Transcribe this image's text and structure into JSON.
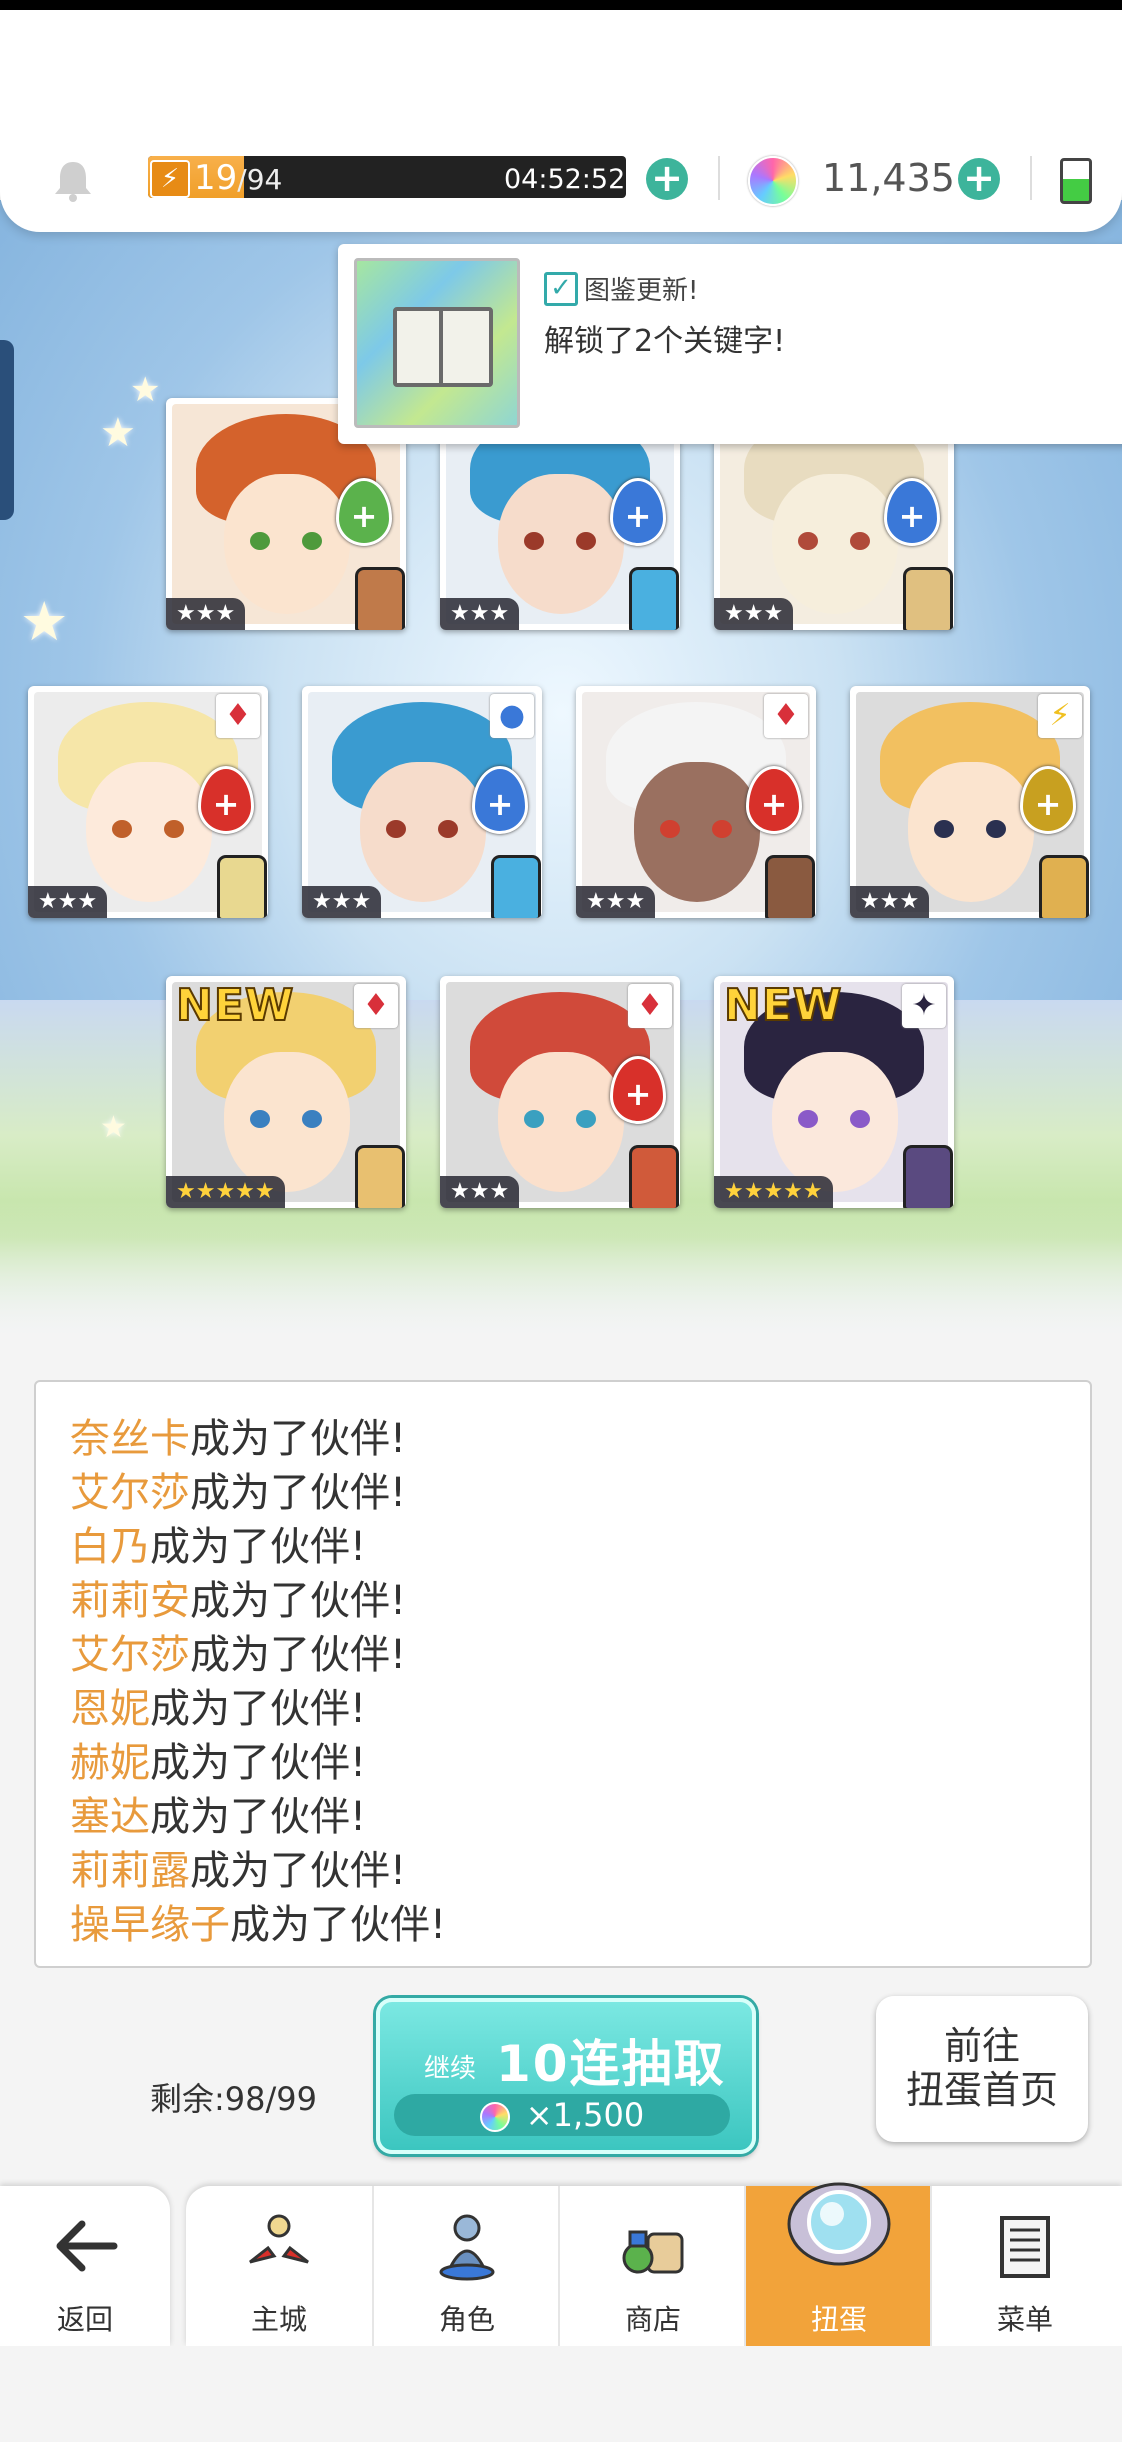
{
  "status": {
    "stamina_current": "19",
    "stamina_max": "/94",
    "stamina_fraction": 0.2,
    "timer": "04:52:52",
    "gems": "11,435"
  },
  "toast": {
    "title": "图鉴更新!",
    "body": "解锁了2个关键字!"
  },
  "cards": [
    {
      "stars": "★★★"
    },
    {
      "stars": "★★★"
    },
    {
      "stars": "★★★"
    },
    {
      "stars": "★★★"
    },
    {
      "stars": "★★★"
    },
    {
      "stars": "★★★"
    },
    {
      "stars": "★★★"
    },
    {
      "stars": "★★★★★",
      "new": "NEW"
    },
    {
      "stars": "★★★"
    },
    {
      "stars": "★★★★★",
      "new": "NEW"
    }
  ],
  "log": {
    "suffix": "成为了伙伴!",
    "names": [
      "奈丝卡",
      "艾尔莎",
      "白乃",
      "莉莉安",
      "艾尔莎",
      "恩妮",
      "赫妮",
      "塞达",
      "莉莉露",
      "操早缘子"
    ]
  },
  "actions": {
    "remaining": "剩余:98/99",
    "continue": "继续",
    "roll_label": "10连抽取",
    "roll_cost": "×1,500",
    "home_line1": "前往",
    "home_line2": "扭蛋首页"
  },
  "nav": {
    "back": "返回",
    "tabs": [
      "主城",
      "角色",
      "商店",
      "扭蛋",
      "菜单"
    ],
    "active_tab": "扭蛋"
  }
}
